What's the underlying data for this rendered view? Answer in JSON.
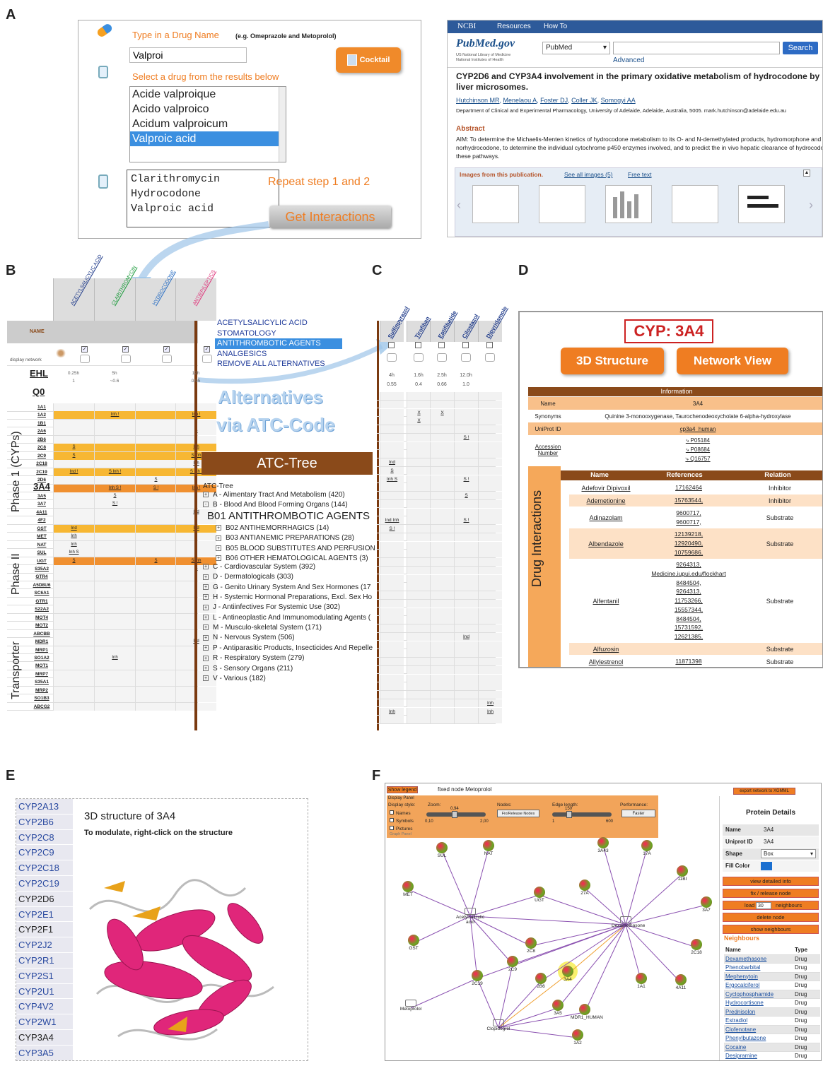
{
  "panels": {
    "A": "A",
    "B": "B",
    "C": "C",
    "D": "D",
    "E": "E",
    "F": "F"
  },
  "panelA": {
    "type_prompt": "Type in a Drug Name",
    "type_example": "(e.g. Omeprazole and Metoprolol)",
    "search_value": "Valproi",
    "cocktail_label": "Cocktail",
    "select_prompt": "Select a drug from the results below",
    "results": [
      "Acide valproique",
      "Acido valproico",
      "Acidum valproicum",
      "Valproic acid"
    ],
    "selected": [
      "Clarithromycin",
      "Hydrocodone",
      "Valproic acid"
    ],
    "repeat_text": "Repeat step 1 and 2",
    "get_label": "Get Interactions"
  },
  "pubmed": {
    "ncbi": "NCBI",
    "resources": "Resources",
    "howto": "How To",
    "logo": "PubMed.gov",
    "lib1": "US National Library of Medicine",
    "lib2": "National Institutes of Health",
    "db": "PubMed",
    "advanced": "Advanced",
    "search": "Search",
    "title": "CYP2D6 and CYP3A4 involvement in the primary oxidative metabolism of hydrocodone by human liver microsomes.",
    "authors": [
      "Hutchinson MR",
      "Menelaou A",
      "Foster DJ",
      "Coller JK",
      "Somogyi AA"
    ],
    "affil": "Department of Clinical and Experimental Pharmacology, University of Adelaide, Adelaide, Australia, 5005. mark.hutchinson@adelaide.edu.au",
    "abstract_h": "Abstract",
    "abstract": "AIM: To determine the Michaelis-Menten kinetics of hydrocodone metabolism to its O- and N-demethylated products, hydromorphone and norhydrocodone, to determine the individual cytochrome p450 enzymes involved, and to predict the in vivo hepatic clearance of hydrocodone via these pathways.",
    "images_h": "Images from this publication.",
    "see_all": "See all images (5)",
    "free_text": "Free text"
  },
  "panelB": {
    "drugs": [
      "ACETYLSALICYLIC ACID",
      "CLARITHROMYCIN",
      "HYDROCODONE",
      "ANTIEPILEPTICS"
    ],
    "name_hdr": "NAME",
    "display_network": "display network",
    "ehl": "EHL",
    "q0": "Q0",
    "ehl_vals": [
      "0.25h",
      "5h",
      "",
      "12h"
    ],
    "q0_vals": [
      "1",
      "~0.6",
      "",
      "0.95"
    ],
    "phase1": "Phase 1 (CYPs)",
    "phase2": "Phase II",
    "transporter": "Transporter",
    "rows": [
      {
        "n": "1A1",
        "c": [
          "",
          "",
          "",
          ""
        ]
      },
      {
        "n": "1A2",
        "c": [
          "",
          "Inh !",
          "",
          "Inh !"
        ],
        "hl": 1
      },
      {
        "n": "1B1",
        "c": [
          "",
          "",
          "",
          ""
        ]
      },
      {
        "n": "2A6",
        "c": [
          "",
          "",
          "",
          "S"
        ]
      },
      {
        "n": "2B6",
        "c": [
          "",
          "",
          "",
          ""
        ]
      },
      {
        "n": "2C8",
        "c": [
          "S",
          "",
          "",
          "Inh"
        ],
        "hl": 1
      },
      {
        "n": "2C9",
        "c": [
          "S",
          "",
          "",
          "S Inh"
        ],
        "hl": 1
      },
      {
        "n": "2C18",
        "c": [
          "",
          "",
          "",
          "Inh"
        ]
      },
      {
        "n": "2C19",
        "c": [
          "Ind !",
          "S Inh !",
          "",
          "S Inh !"
        ],
        "hl": 1
      },
      {
        "n": "2D6",
        "c": [
          "",
          "",
          "S",
          ""
        ]
      },
      {
        "n": "3A4",
        "c": [
          "",
          "Inh S !",
          "S !",
          "Inh !"
        ],
        "hl": 2
      },
      {
        "n": "3A5",
        "c": [
          "",
          "S",
          "",
          ""
        ]
      },
      {
        "n": "3A7",
        "c": [
          "",
          "S !",
          "",
          ""
        ]
      },
      {
        "n": "4A11",
        "c": [
          "",
          "",
          "",
          "Ind"
        ]
      },
      {
        "n": "4F2",
        "c": [
          "",
          "",
          "",
          ""
        ]
      },
      {
        "n": "GST",
        "c": [
          "Ind",
          "",
          "",
          "Ind"
        ],
        "hl": 1
      },
      {
        "n": "MET",
        "c": [
          "Inh",
          "",
          "",
          ""
        ]
      },
      {
        "n": "NAT",
        "c": [
          "Inh",
          "",
          "",
          ""
        ]
      },
      {
        "n": "SUL",
        "c": [
          "Inh S",
          "",
          "",
          ""
        ]
      },
      {
        "n": "UGT",
        "c": [
          "S",
          "",
          "S",
          "S Inh"
        ],
        "hl": 2
      },
      {
        "n": "S35A2",
        "c": [
          "",
          "",
          "",
          "S"
        ]
      },
      {
        "n": "GTR4",
        "c": [
          "",
          "",
          "",
          ""
        ]
      },
      {
        "n": "A5D8U6",
        "c": [
          "",
          "",
          "",
          ""
        ]
      },
      {
        "n": "SC6A1",
        "c": [
          "",
          "",
          "",
          ""
        ]
      },
      {
        "n": "GTR1",
        "c": [
          "",
          "",
          "",
          ""
        ]
      },
      {
        "n": "S22A2",
        "c": [
          "",
          "",
          "",
          ""
        ]
      },
      {
        "n": "MOT4",
        "c": [
          "",
          "",
          "",
          ""
        ]
      },
      {
        "n": "MOT2",
        "c": [
          "",
          "",
          "",
          ""
        ]
      },
      {
        "n": "ABCBB",
        "c": [
          "",
          "",
          "",
          ""
        ]
      },
      {
        "n": "MDR1",
        "c": [
          "",
          "",
          "",
          "Ind"
        ]
      },
      {
        "n": "MRP1",
        "c": [
          "",
          "",
          "",
          ""
        ]
      },
      {
        "n": "SO1A2",
        "c": [
          "",
          "Inh",
          "",
          ""
        ]
      },
      {
        "n": "MOT1",
        "c": [
          "",
          "",
          "",
          ""
        ]
      },
      {
        "n": "MRP7",
        "c": [
          "",
          "",
          "",
          ""
        ]
      },
      {
        "n": "S35A1",
        "c": [
          "",
          "",
          "",
          ""
        ]
      },
      {
        "n": "MRP2",
        "c": [
          "",
          "",
          "",
          ""
        ]
      },
      {
        "n": "SO1B3",
        "c": [
          "",
          "",
          "",
          ""
        ]
      },
      {
        "n": "ABCG2",
        "c": [
          "",
          "",
          "",
          ""
        ]
      }
    ],
    "menu": [
      "ACETYLSALICYLIC ACID",
      "STOMATOLOGY",
      "ANTITHROMBOTIC AGENTS",
      "ANALGESICS",
      "REMOVE ALL ALTERNATIVES"
    ],
    "alt1": "Alternatives",
    "alt2": "via ATC-Code",
    "atc_title": "ATC-Tree",
    "atc_root": "ATC-Tree",
    "tree": [
      {
        "t": "A - Alimentary Tract And Metabolism (420)",
        "l": 0,
        "s": "+"
      },
      {
        "t": "B - Blood And Blood Forming Organs (144)",
        "l": 0,
        "s": "-"
      },
      {
        "t": "B01 ANTITHROMBOTIC AGENTS",
        "l": 1,
        "s": "",
        "big": 1
      },
      {
        "t": "B02 ANTIHEMORRHAGICS (14)",
        "l": 2,
        "s": "+"
      },
      {
        "t": "B03 ANTIANEMIC PREPARATIONS (28)",
        "l": 2,
        "s": "+"
      },
      {
        "t": "B05 BLOOD SUBSTITUTES AND PERFUSION",
        "l": 2,
        "s": "+"
      },
      {
        "t": "B06 OTHER HEMATOLOGICAL AGENTS (3)",
        "l": 2,
        "s": "+"
      },
      {
        "t": "C - Cardiovascular System (392)",
        "l": 0,
        "s": "+"
      },
      {
        "t": "D - Dermatologicals (303)",
        "l": 0,
        "s": "+"
      },
      {
        "t": "G - Genito Urinary System And Sex Hormones (17",
        "l": 0,
        "s": "+"
      },
      {
        "t": "H - Systemic Hormonal Preparations, Excl. Sex Ho",
        "l": 0,
        "s": "+"
      },
      {
        "t": "J - Antiinfectives For Systemic Use (302)",
        "l": 0,
        "s": "+"
      },
      {
        "t": "L - Antineoplastic And Immunomodulating Agents (",
        "l": 0,
        "s": "+"
      },
      {
        "t": "M - Musculo-skeletal System (171)",
        "l": 0,
        "s": "+"
      },
      {
        "t": "N - Nervous System (506)",
        "l": 0,
        "s": "+"
      },
      {
        "t": "P - Antiparasitic Products, Insecticides And Repelle",
        "l": 0,
        "s": "+"
      },
      {
        "t": "R - Respiratory System (279)",
        "l": 0,
        "s": "+"
      },
      {
        "t": "S - Sensory Organs (211)",
        "l": 0,
        "s": "+"
      },
      {
        "t": "V - Various (182)",
        "l": 0,
        "s": "+"
      }
    ]
  },
  "panelC": {
    "drugs": [
      "Sulfinpyrazol",
      "Tirofiban",
      "Eptifibatide",
      "Cilostazol",
      "Dipyridamole"
    ],
    "ehl": [
      "4h",
      "1.6h",
      "2.5h",
      "12.0h",
      ""
    ],
    "q0": [
      "0.55",
      "0.4",
      "0.66",
      "1.0",
      ""
    ],
    "cells": {
      "2": [
        "",
        "X",
        "X",
        "",
        ""
      ],
      "3": [
        "",
        "X",
        "",
        "",
        ""
      ],
      "5": [
        "",
        "",
        "",
        "S !",
        ""
      ],
      "8": [
        "Ind",
        "",
        "",
        "",
        ""
      ],
      "9": [
        "S",
        "",
        "",
        "",
        ""
      ],
      "10": [
        "Inh S",
        "",
        "",
        "S !",
        ""
      ],
      "12": [
        "",
        "",
        "",
        "S",
        ""
      ],
      "15": [
        "Ind Inh",
        "",
        "",
        "S !",
        ""
      ],
      "16": [
        "S !",
        "",
        "",
        "",
        ""
      ],
      "29": [
        "",
        "",
        "",
        "Ind",
        ""
      ],
      "37": [
        "",
        "",
        "",
        "",
        "Inh"
      ],
      "38": [
        "Inh",
        "",
        "",
        "",
        "Inh"
      ]
    }
  },
  "panelD": {
    "title": "CYP: 3A4",
    "btn_3d": "3D Structure",
    "btn_net": "Network View",
    "info_hdr": "Information",
    "info": [
      [
        "Name",
        "3A4"
      ],
      [
        "Synonyms",
        "Quinine 3-monooxygenase, Taurochenodeoxycholate 6-alpha-hydroxylase"
      ],
      [
        "UniProt ID",
        "cp3a4_human"
      ],
      [
        "Accession Number",
        "P05184\nP08684\nQ16757"
      ]
    ],
    "side_label": "Drug Interactions",
    "cols": [
      "Name",
      "References",
      "Relation"
    ],
    "rows": [
      [
        "Adefovir Dipivoxil",
        "17162464",
        "Inhibitor"
      ],
      [
        "Ademetionine",
        "15763544,",
        "Inhibitor"
      ],
      [
        "Adinazolam",
        "9600717,\n9600717,",
        "Substrate"
      ],
      [
        "Albendazole",
        "12139218,\n12920490,\n10759686,",
        "Substrate"
      ],
      [
        "Alfentanil",
        "9264313,\nMedicine.iupui.edu/flockhart\n8484504,\n9264313,\n11753266,\n15557344,\n8484504,\n15731592,\n12621385,",
        "Substrate"
      ],
      [
        "Alfuzosin",
        "",
        "Substrate"
      ],
      [
        "Allylestrenol",
        "11871398",
        "Substrate"
      ]
    ]
  },
  "panelE": {
    "cyps": [
      "CYP2A13",
      "CYP2B6",
      "CYP2C8",
      "CYP2C9",
      "CYP2C18",
      "CYP2C19",
      "CYP2D6",
      "CYP2E1",
      "CYP2F1",
      "CYP2J2",
      "CYP2R1",
      "CYP2S1",
      "CYP2U1",
      "CYP4V2",
      "CYP2W1",
      "CYP3A4",
      "CYP3A5"
    ],
    "title": "3D structure of 3A4",
    "hint": "To modulate, right-click on the structure"
  },
  "panelF": {
    "show_legend": "Show legend",
    "fixed_node": "fixed node Metoprolol",
    "export": "export network to XGMML",
    "display_panel": "Display Panel",
    "display_style": "Display style:",
    "opts": [
      "Names",
      "Symbols",
      "Pictures"
    ],
    "zoom": "Zoom:",
    "zoom_val": "0,94",
    "zoom_min": "0,10",
    "zoom_max": "2,00",
    "nodes": "Nodes:",
    "fix_release": "Fix/Release Nodes",
    "edge": "Edge length:",
    "edge_val": "150",
    "edge_min": "1",
    "edge_max": "600",
    "perf": "Performance:",
    "faster": "Faster",
    "graph_panel": "Graph Panel",
    "pd_title": "Protein Details",
    "pd": [
      [
        "Name",
        "3A4"
      ],
      [
        "Uniprot ID",
        "3A4"
      ],
      [
        "Shape",
        "Box"
      ],
      [
        "Fill Color",
        ""
      ]
    ],
    "actions": [
      "view detailed info",
      "fix / release node",
      "delete node",
      "show neighbours"
    ],
    "load": "load",
    "load_val": "30",
    "neighbours_lbl": "neighbours",
    "nb_title": "Neighbours",
    "nb_cols": [
      "Name",
      "Type"
    ],
    "neighbours": [
      [
        "Dexamethasone",
        "Drug"
      ],
      [
        "Phenobarbital",
        "Drug"
      ],
      [
        "Mephenytoin",
        "Drug"
      ],
      [
        "Ergocalciferol",
        "Drug"
      ],
      [
        "Cyclophosphamide",
        "Drug"
      ],
      [
        "Hydrocortisone",
        "Drug"
      ],
      [
        "Prednisolon",
        "Drug"
      ],
      [
        "Estradiol",
        "Drug"
      ],
      [
        "Clofenotane",
        "Drug"
      ],
      [
        "Phenylbutazone",
        "Drug"
      ],
      [
        "Cocaine",
        "Drug"
      ],
      [
        "Desipramine",
        "Drug"
      ]
    ],
    "graph_nodes": [
      "SUL",
      "NAT",
      "3A43",
      "17A",
      "11BI",
      "MET",
      "UGT",
      "27A",
      "3A7",
      "Acetylsalicylic acid",
      "Dexamethasone",
      "GST",
      "2C8",
      "2C18",
      "2C9",
      "3A4",
      "2B6",
      "1A1",
      "4A11",
      "2C19",
      "3A5",
      "MDR1_HUMAN",
      "Metoprolol",
      "Clopidogrel",
      "1A2"
    ]
  }
}
